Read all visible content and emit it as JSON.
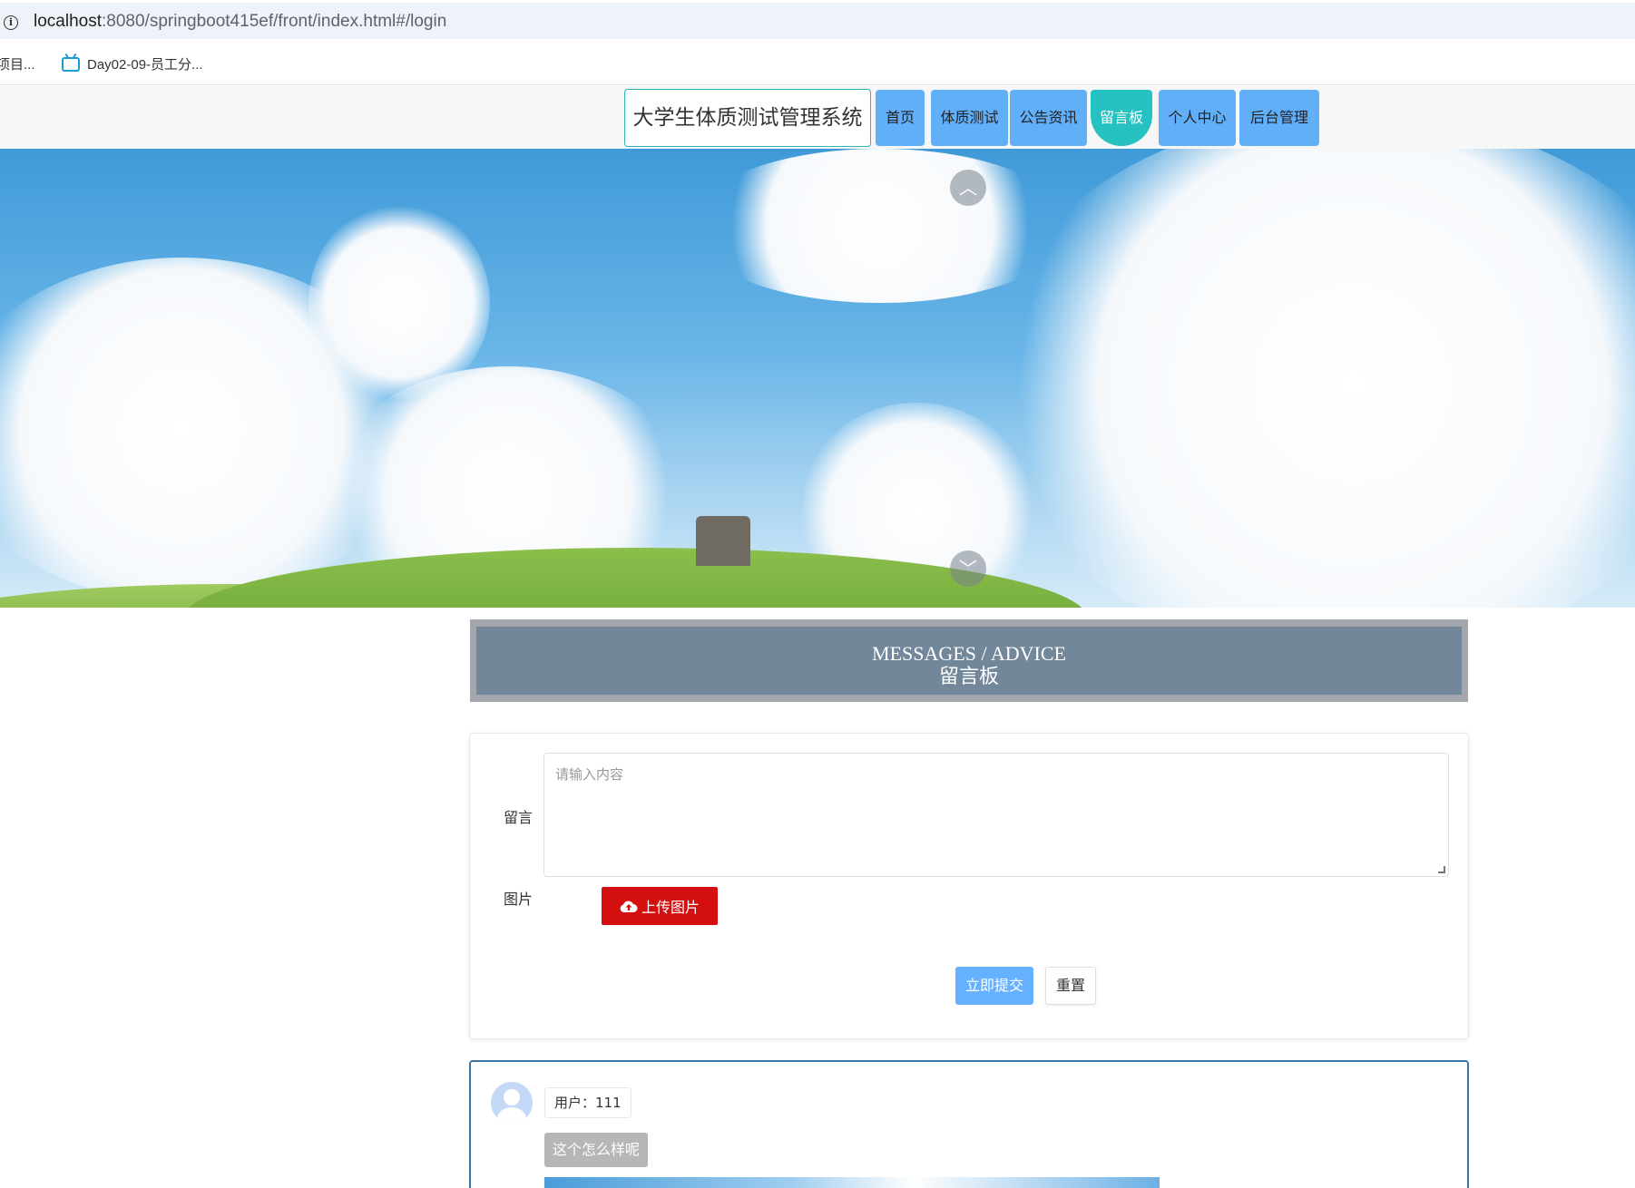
{
  "browser": {
    "url_host": "localhost",
    "url_path": ":8080/springboot415ef/front/index.html#/login",
    "bookmarks": [
      {
        "label": "项目..."
      },
      {
        "label": "Day02-09-员工分..."
      }
    ]
  },
  "header": {
    "site_title": "大学生体质测试管理系统",
    "nav": [
      {
        "label": "首页"
      },
      {
        "label": "体质测试"
      },
      {
        "label": "公告资讯"
      },
      {
        "label": "留言板",
        "active": true
      },
      {
        "label": "个人中心"
      },
      {
        "label": "后台管理"
      }
    ]
  },
  "banner": {
    "prev_arrow": "︿",
    "next_arrow": "﹀"
  },
  "section": {
    "title_en": "MESSAGES / ADVICE",
    "title_cn": "留言板"
  },
  "form": {
    "message_label": "留言",
    "message_placeholder": "请输入内容",
    "image_label": "图片",
    "upload_label": "上传图片",
    "submit_label": "立即提交",
    "reset_label": "重置"
  },
  "comments": [
    {
      "user": "用户：111",
      "content": "这个怎么样呢"
    }
  ],
  "colors": {
    "nav_button": "#61aef9",
    "nav_active": "#26c1c1",
    "upload_button": "#d40f0f",
    "submit_button": "#66b1ff",
    "section_header": "#73879b"
  }
}
